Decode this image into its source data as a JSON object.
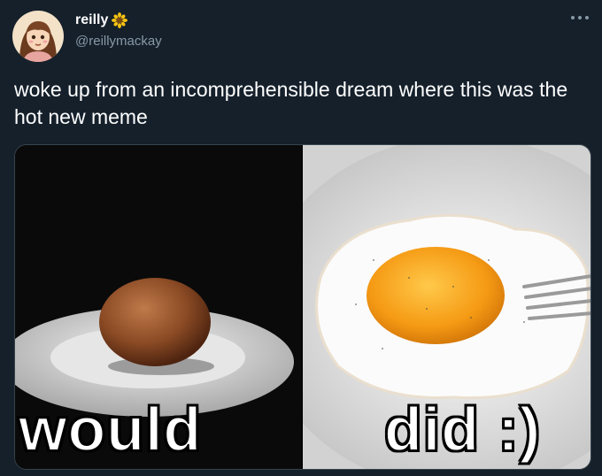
{
  "user": {
    "display_name": "reilly",
    "handle": "@reillymackay",
    "name_emoji_icon": "sunflower-icon",
    "avatar_icon": "avatar-illustration"
  },
  "header": {
    "more_icon": "more-horizontal-icon"
  },
  "tweet": {
    "text": "woke up from an incomprehensible dream where this was the hot new meme"
  },
  "media": {
    "left_caption": "would",
    "right_caption": "did :)"
  },
  "colors": {
    "background": "#15202b",
    "text": "#ffffff",
    "secondary_text": "#8899a6",
    "border": "#38444d"
  }
}
